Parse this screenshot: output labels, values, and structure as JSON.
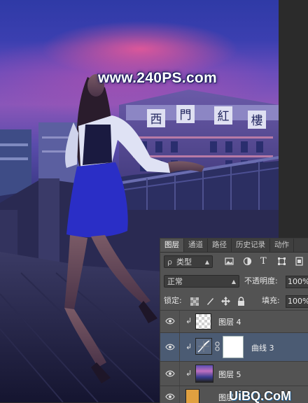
{
  "watermark": "www.240PS.com",
  "tabs": [
    {
      "label": "图层",
      "active": true
    },
    {
      "label": "通道"
    },
    {
      "label": "路径"
    },
    {
      "label": "历史记录"
    },
    {
      "label": "动作"
    }
  ],
  "filter": {
    "search_glyph": "ρ",
    "kind": "类型"
  },
  "blend_mode": "正常",
  "opacity": {
    "label": "不透明度:",
    "value": "100%"
  },
  "lock": {
    "label": "锁定:"
  },
  "fill": {
    "label": "填充:",
    "value": "100%"
  },
  "layers": [
    {
      "name": "图层 4",
      "selected": false
    },
    {
      "name": "曲线 3",
      "selected": true
    },
    {
      "name": "图层 5",
      "selected": false
    },
    {
      "name": "图层",
      "selected": false
    }
  ],
  "sign_text": [
    "西",
    "門",
    "紅",
    "樓"
  ],
  "bottom_watermark": "UiBQ.CoM",
  "colors": {
    "panel_bg": "#535353",
    "selected_row": "#4b5b73",
    "accent": "#2b86d6"
  }
}
